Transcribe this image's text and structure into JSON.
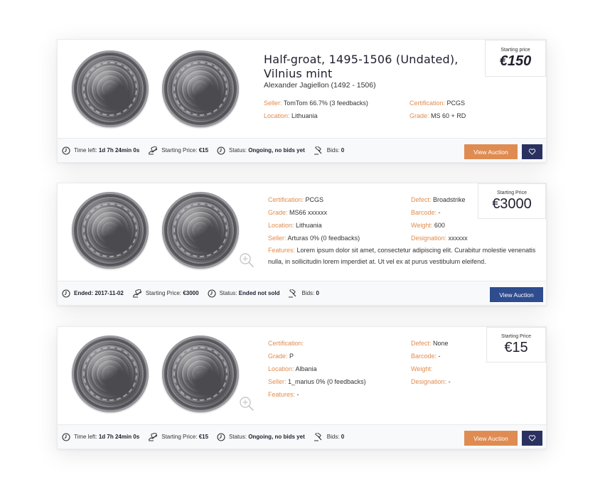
{
  "cards": [
    {
      "title": "Half-groat, 1495-1506 (Undated), Vilnius mint",
      "subtitle": "Alexander Jagiellon (1492 - 1506)",
      "price_label": "Starting price",
      "price_value": "€150",
      "fields": [
        {
          "key": "Seller:",
          "value": "TomTom 66.7% (3 feedbacks)"
        },
        {
          "key": "Location:",
          "value": "Lithuania"
        },
        {
          "key": "Certification:",
          "value": "PCGS"
        },
        {
          "key": "Grade:",
          "value": "MS 60 + RD"
        }
      ],
      "footer": {
        "time_label": "Time left:",
        "time_value": "1d 7h 24min 0s",
        "price_label": "Starting Price:",
        "price_value": "€15",
        "status_label": "Status:",
        "status_value": "Ongoing, no bids yet",
        "bids_label": "Bids:",
        "bids_value": "0"
      },
      "button_label": "View Auction",
      "heart_icon": "heart-icon"
    },
    {
      "price_label": "Starting Price",
      "price_value": "€3000",
      "fields_left": [
        {
          "key": "Certification:",
          "value": "PCGS"
        },
        {
          "key": "Grade:",
          "value": "MS66 xxxxxx"
        },
        {
          "key": "Location:",
          "value": "Lithuania"
        },
        {
          "key": "Seller:",
          "value": "Arturas 0% (0 feedbacks)"
        }
      ],
      "fields_right": [
        {
          "key": "Defect:",
          "value": "Broadstrike"
        },
        {
          "key": "Barcode:",
          "value": "-"
        },
        {
          "key": "Weight:",
          "value": "600"
        },
        {
          "key": "Designation:",
          "value": "xxxxxx"
        }
      ],
      "features_key": "Features:",
      "features_value": "Lorem ipsum dolor sit amet, consectetur adipiscing elit. Curabitur molestie venenatis nulla, in sollicitudin lorem imperdiet at. Ut vel ex at purus vestibulum eleifend.",
      "footer": {
        "time_label": "Ended:",
        "time_value": "2017-11-02",
        "price_label": "Starting Price:",
        "price_value": "€3000",
        "status_label": "Status:",
        "status_value": "Ended not sold",
        "bids_label": "Bids:",
        "bids_value": "0"
      },
      "button_label": "View Auction"
    },
    {
      "price_label": "Starting Price",
      "price_value": "€15",
      "fields_left": [
        {
          "key": "Certification:",
          "value": ""
        },
        {
          "key": "Grade:",
          "value": "P"
        },
        {
          "key": "Location:",
          "value": "Albania"
        },
        {
          "key": "Seller:",
          "value": "1_marius 0% (0 feedbacks)"
        },
        {
          "key": "Features:",
          "value": "-"
        }
      ],
      "fields_right": [
        {
          "key": "Defect:",
          "value": "None"
        },
        {
          "key": "Barcode:",
          "value": "-"
        },
        {
          "key": "Weight:",
          "value": ""
        },
        {
          "key": "Designation:",
          "value": "-"
        }
      ],
      "footer": {
        "time_label": "Time left:",
        "time_value": "1d 7h 24min 0s",
        "price_label": "Starting Price:",
        "price_value": "€15",
        "status_label": "Status:",
        "status_value": "Ongoing, no bids yet",
        "bids_label": "Bids:",
        "bids_value": "0"
      },
      "button_label": "View Auction",
      "heart_icon": "heart-icon"
    }
  ],
  "colors": {
    "accent_orange": "#df8c52",
    "button_blue": "#2e4c8e",
    "heart_navy": "#2a3160"
  }
}
